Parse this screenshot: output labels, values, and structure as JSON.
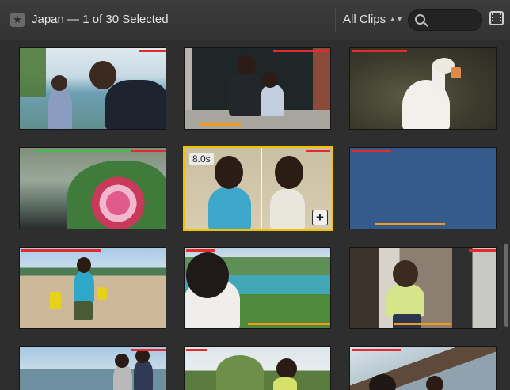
{
  "header": {
    "title": "Japan — 1 of 30 Selected",
    "filter_label": "All Clips",
    "search_placeholder": ""
  },
  "icons": {
    "library": "star-icon",
    "filter": "updown-arrows-icon",
    "search": "magnifier-icon",
    "view": "filmstrip-icon"
  },
  "colors": {
    "selection": "#f2c200",
    "favorite_marker": "#e32b2b",
    "used_marker": "#f29a1b",
    "green_marker": "#3fbf4b"
  },
  "selected_clip": {
    "duration": "8.0s",
    "add_symbol": "+"
  }
}
